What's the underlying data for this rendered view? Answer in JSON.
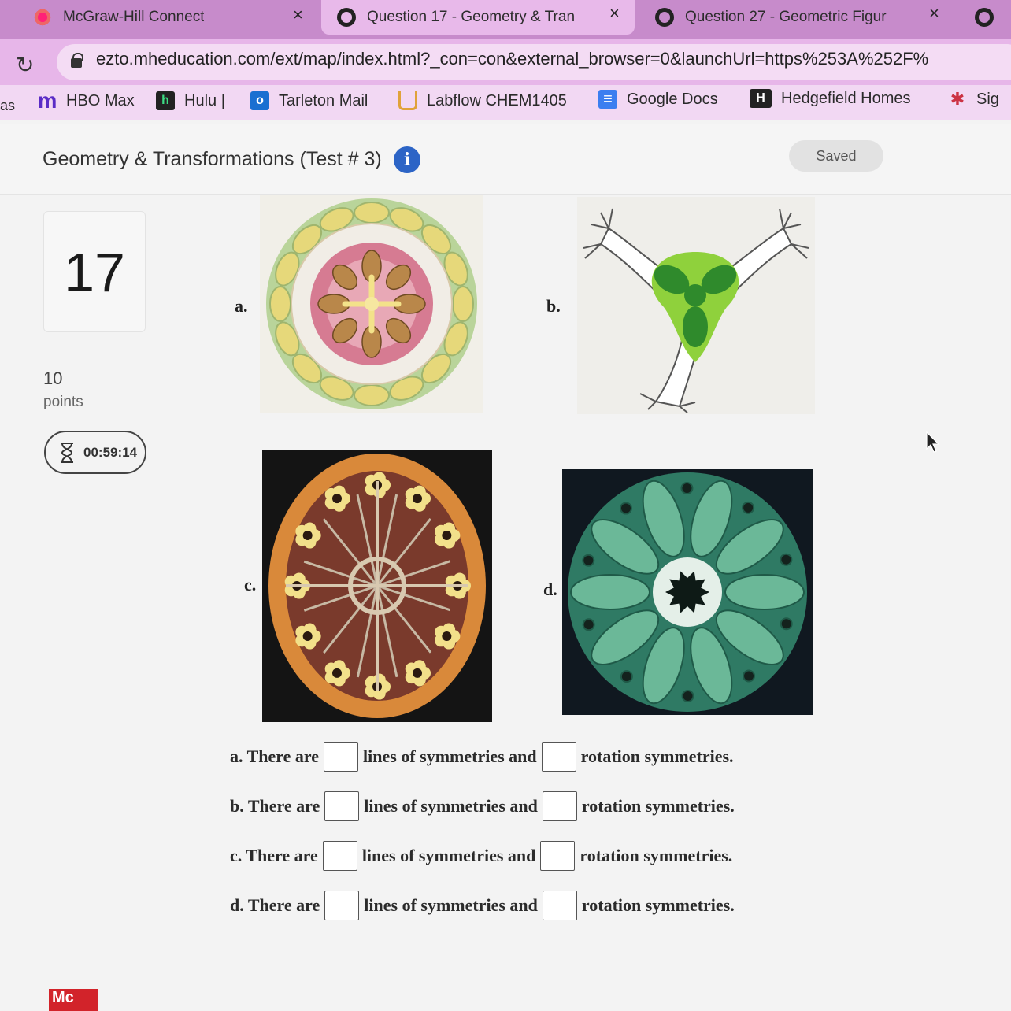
{
  "tabs": [
    {
      "title": "McGraw-Hill Connect",
      "close": "×"
    },
    {
      "title": "Question 17 - Geometry & Tran",
      "close": "×"
    },
    {
      "title": "Question 27 - Geometric Figur",
      "close": "×"
    }
  ],
  "address": {
    "url": "ezto.mheducation.com/ext/map/index.html?_con=con&external_browser=0&launchUrl=https%253A%252F%"
  },
  "bookmarks": [
    {
      "label": "as",
      "icon": "text-fragment"
    },
    {
      "label": "HBO Max",
      "icon": "hbo-max-icon"
    },
    {
      "label": "Hulu |",
      "icon": "hulu-icon"
    },
    {
      "label": "Tarleton Mail",
      "icon": "outlook-icon"
    },
    {
      "label": "Labflow CHEM1405",
      "icon": "labflow-icon"
    },
    {
      "label": "Google Docs",
      "icon": "google-docs-icon"
    },
    {
      "label": "Hedgefield Homes",
      "icon": "hedgefield-icon"
    },
    {
      "label": "Sig",
      "icon": "sig-icon"
    }
  ],
  "header": {
    "title": "Geometry & Transformations (Test # 3)",
    "info": "i",
    "status": "Saved"
  },
  "question": {
    "number": "17",
    "points_value": "10",
    "points_label": "points",
    "timer": "00:59:14"
  },
  "figures": {
    "a": "a.",
    "b": "b.",
    "c": "c.",
    "d": "d."
  },
  "items": [
    {
      "prefix": "a. There are",
      "middle": "lines of symmetries and",
      "suffix": "rotation symmetries."
    },
    {
      "prefix": "b. There are",
      "middle": "lines of symmetries and",
      "suffix": "rotation symmetries."
    },
    {
      "prefix": "c. There are",
      "middle": "lines of symmetries and",
      "suffix": "rotation symmetries."
    },
    {
      "prefix": "d. There are",
      "middle": "lines of symmetries and",
      "suffix": "rotation symmetries."
    }
  ],
  "footer": {
    "logo": "Mc"
  },
  "colors": {
    "tabstrip": "#c78bcb",
    "info": "#2c64c6",
    "logo": "#d2232a"
  }
}
